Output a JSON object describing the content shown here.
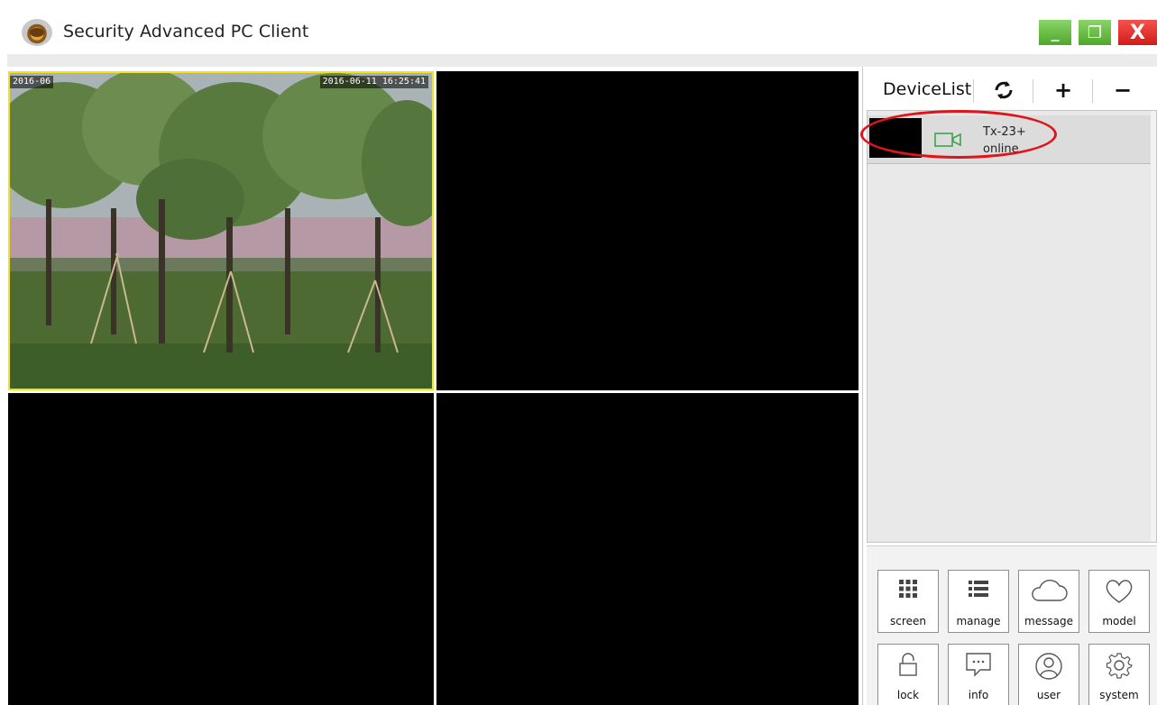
{
  "window": {
    "title": "Security Advanced PC Client",
    "min_symbol": "_",
    "restore_symbol": "❐",
    "close_symbol": "X"
  },
  "video": {
    "osd_left": "2016-06",
    "osd_right": "2016-06-11 16:25:41"
  },
  "device_list": {
    "title": "DeviceList",
    "refresh_symbol": "⟲",
    "add_symbol": "+",
    "remove_symbol": "−",
    "devices": [
      {
        "name": "Tx-23+",
        "status": "online",
        "icon": "camera-icon"
      }
    ]
  },
  "functions": [
    {
      "label": "screen",
      "icon": "grid-icon"
    },
    {
      "label": "manage",
      "icon": "list-icon"
    },
    {
      "label": "message",
      "icon": "cloud-icon"
    },
    {
      "label": "model",
      "icon": "heart-icon"
    },
    {
      "label": "lock",
      "icon": "lock-icon"
    },
    {
      "label": "info",
      "icon": "chat-icon"
    },
    {
      "label": "user",
      "icon": "user-icon"
    },
    {
      "label": "system",
      "icon": "gear-icon"
    }
  ],
  "colors": {
    "selected_cell_border": "#f3e21c",
    "highlight_annotation": "#e0141a",
    "online_icon": "#3aa64a",
    "window_button_green": "#4fa72b",
    "window_button_red": "#d11c18"
  }
}
